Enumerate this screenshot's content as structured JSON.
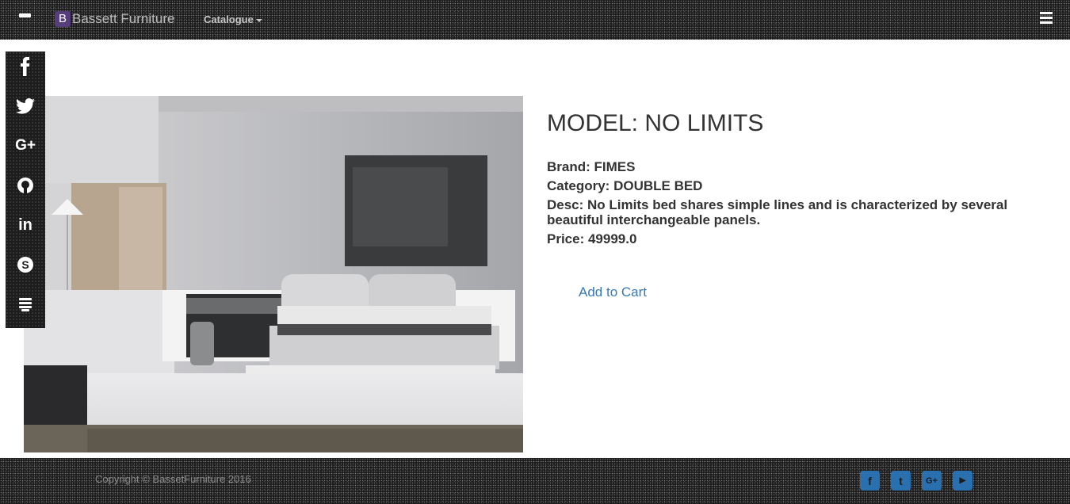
{
  "navbar": {
    "brand_letter": "B",
    "brand_name": "Bassett Furniture",
    "catalogue_label": "Catalogue"
  },
  "social_sidebar": {
    "icons": [
      "facebook-icon",
      "twitter-icon",
      "google-plus-icon",
      "github-icon",
      "linkedin-icon",
      "skype-icon",
      "stack-icon"
    ]
  },
  "product": {
    "title": "MODEL: NO LIMITS",
    "brand": "Brand: FIMES",
    "category": "Category: DOUBLE BED",
    "desc": "Desc: No Limits bed shares simple lines and is characterized by several beautiful interchangeable panels.",
    "price": "Price: 49999.0",
    "add_to_cart": "Add to Cart"
  },
  "footer": {
    "copyright": "Copyright © BassetFurniture 2016",
    "icons": [
      "facebook-square-icon",
      "twitter-square-icon",
      "google-plus-square-icon",
      "youtube-square-icon"
    ]
  },
  "colors": {
    "link": "#337ab7",
    "brand_logo": "#563d7c",
    "footer_icon": "#2a6fae"
  }
}
